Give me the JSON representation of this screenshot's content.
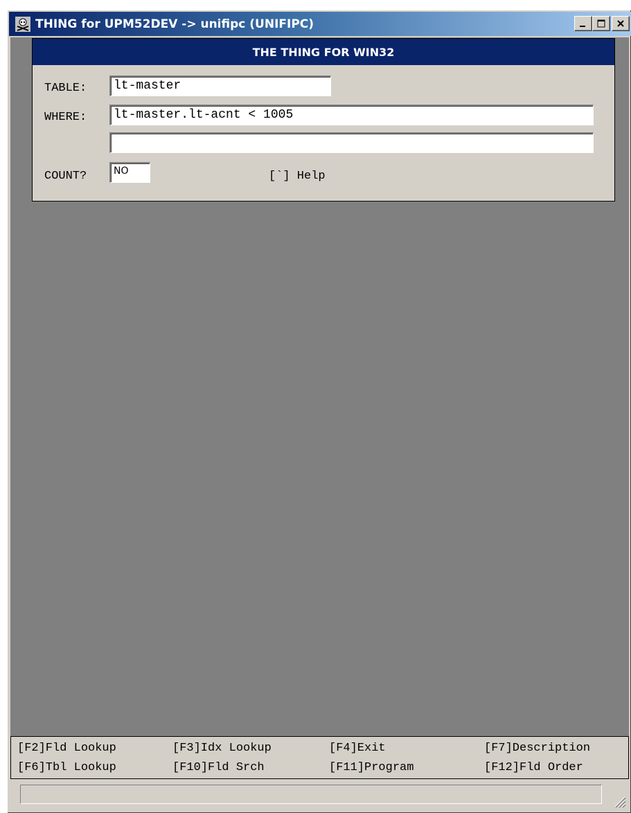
{
  "window": {
    "title": "THING for UPM52DEV -> unifipc (UNIFIPC)",
    "icon": "skull-crossbones-icon",
    "buttons": [
      "minimize-icon",
      "maximize-icon",
      "close-icon"
    ]
  },
  "panel": {
    "header": "THE THING FOR WIN32",
    "table_label": "TABLE:",
    "table_value": "lt-master",
    "where_label": "WHERE:",
    "where_value": "lt-master.lt-acnt < 1005",
    "where_value_2": "",
    "count_label": "COUNT?",
    "count_value": "NO",
    "help_text": "[`] Help"
  },
  "function_keys": {
    "row1": [
      "[F2]Fld Lookup",
      "[F3]Idx Lookup",
      "[F4]Exit",
      "[F7]Description"
    ],
    "row2": [
      "[F6]Tbl Lookup",
      "[F10]Fld Srch",
      "[F11]Program",
      "[F12]Fld Order"
    ]
  },
  "status": {
    "text": ""
  },
  "colors": {
    "title_bar_start": "#0a246a",
    "title_bar_end": "#a6caf0",
    "panel_header": "#0a246a",
    "client_background": "#808080",
    "chrome": "#d4d0c8"
  }
}
